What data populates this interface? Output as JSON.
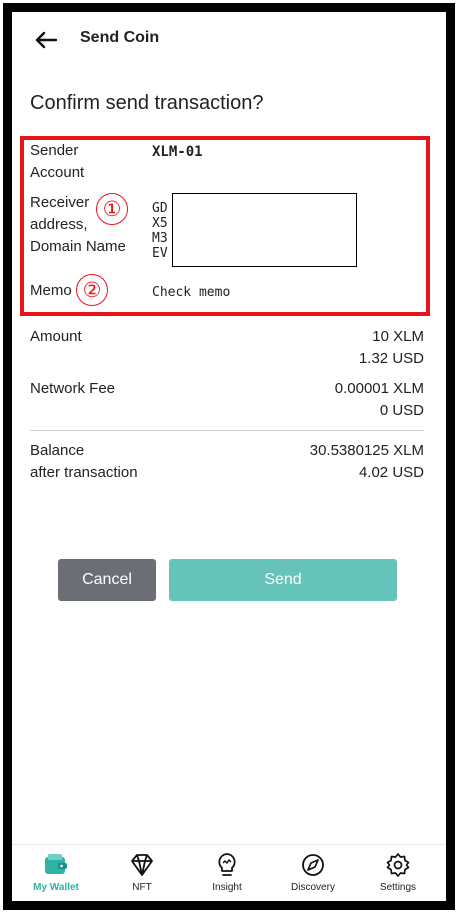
{
  "header": {
    "title": "Send Coin"
  },
  "page_title": "Confirm send transaction?",
  "details": {
    "sender_label": [
      "Sender",
      "Account"
    ],
    "sender_value": "XLM-01",
    "receiver_label": [
      "Receiver",
      "address,",
      "Domain Name"
    ],
    "receiver_value_lines": [
      "GD",
      "X5",
      "M3",
      "EV"
    ],
    "memo_label": "Memo",
    "memo_value": "Check memo",
    "markers": [
      "①",
      "②"
    ]
  },
  "summary": {
    "amount_label": "Amount",
    "amount_values": [
      "10 XLM",
      "1.32 USD"
    ],
    "fee_label": "Network Fee",
    "fee_values": [
      "0.00001 XLM",
      "0 USD"
    ],
    "balance_label": [
      "Balance",
      "after transaction"
    ],
    "balance_values": [
      "30.5380125 XLM",
      "4.02 USD"
    ]
  },
  "buttons": {
    "cancel": "Cancel",
    "send": "Send"
  },
  "tabs": [
    {
      "label": "My Wallet",
      "icon": "wallet-icon",
      "active": true
    },
    {
      "label": "NFT",
      "icon": "diamond-icon",
      "active": false
    },
    {
      "label": "Insight",
      "icon": "lightbulb-icon",
      "active": false
    },
    {
      "label": "Discovery",
      "icon": "compass-icon",
      "active": false
    },
    {
      "label": "Settings",
      "icon": "gear-icon",
      "active": false
    }
  ],
  "colors": {
    "accent": "#2fb3a6",
    "send_button": "#66c3b9",
    "cancel_button": "#6b6e75",
    "highlight": "#e8141a"
  }
}
